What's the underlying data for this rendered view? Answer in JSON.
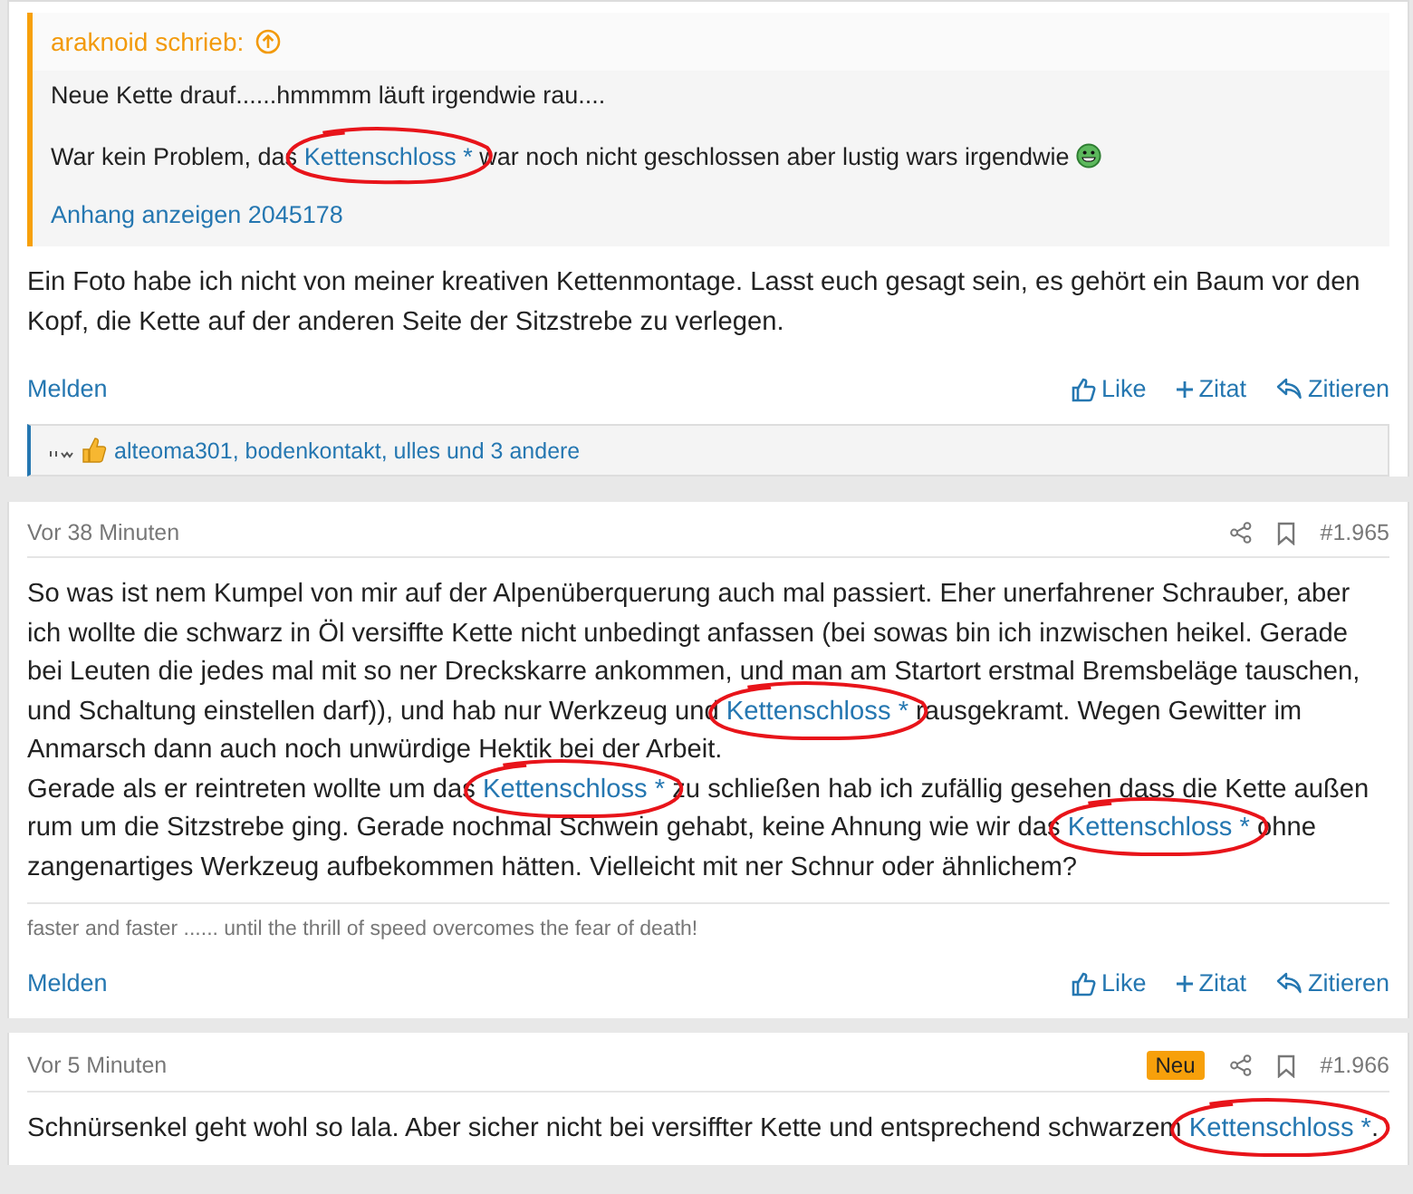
{
  "posts": [
    {
      "quote": {
        "author": "araknoid schrieb:",
        "lines": [
          [
            {
              "kind": "text",
              "text": "Neue Kette drauf......hmmmm läuft irgendwie rau...."
            }
          ],
          [
            {
              "kind": "text",
              "text": "War kein Problem, das "
            },
            {
              "kind": "link",
              "text": "Kettenschloss *",
              "circled": true
            },
            {
              "kind": "text",
              "text": " war noch nicht geschlossen aber lustig wars irgendwie "
            },
            {
              "kind": "smiley"
            }
          ]
        ],
        "attachment": "Anhang anzeigen 2045178"
      },
      "body": [
        [
          {
            "kind": "text",
            "text": "Ein Foto habe ich nicht von meiner kreativen Kettenmontage. Lasst euch gesagt sein, es gehört ein Baum vor den Kopf, die Kette auf der anderen Seite der Sitzstrebe zu verlegen."
          }
        ]
      ],
      "actions": {
        "report": "Melden",
        "like": "Like",
        "quote": "Zitat",
        "reply": "Zitieren"
      },
      "reactions": "alteoma301, bodenkontakt, ulles und 3 andere"
    },
    {
      "header": {
        "time": "Vor 38 Minuten",
        "number": "#1.965"
      },
      "body": [
        [
          {
            "kind": "text",
            "text": "So was ist nem Kumpel von mir auf der Alpenüberquerung auch mal passiert. Eher unerfahrener Schrauber, aber ich wollte die schwarz in Öl versiffte Kette nicht unbedingt anfassen (bei sowas bin ich inzwischen heikel. Gerade bei Leuten die jedes mal mit so ner Dreckskarre ankommen, und man am Startort erstmal Bremsbeläge tauschen, und Schaltung einstellen darf)), und hab nur Werkzeug und "
          },
          {
            "kind": "link",
            "text": "Kettenschloss *",
            "circled": true
          },
          {
            "kind": "text",
            "text": " rausgekramt. Wegen Gewitter im Anmarsch dann auch noch unwürdige Hektik bei der Arbeit."
          }
        ],
        [
          {
            "kind": "text",
            "text": "Gerade als er reintreten wollte um das "
          },
          {
            "kind": "link",
            "text": "Kettenschloss *",
            "circled": true
          },
          {
            "kind": "text",
            "text": " zu schließen hab ich zufällig gesehen dass die Kette außen rum um die Sitzstrebe ging. Gerade nochmal Schwein gehabt, keine Ahnung wie wir das "
          },
          {
            "kind": "link",
            "text": "Kettenschloss *",
            "circled": true
          },
          {
            "kind": "text",
            "text": " ohne zangenartiges Werkzeug aufbekommen hätten. Vielleicht mit ner Schnur oder ähnlichem?"
          }
        ]
      ],
      "signature": "faster and faster ...... until the thrill of speed overcomes the fear of death!",
      "actions": {
        "report": "Melden",
        "like": "Like",
        "quote": "Zitat",
        "reply": "Zitieren"
      }
    },
    {
      "header": {
        "time": "Vor 5 Minuten",
        "badge": "Neu",
        "number": "#1.966"
      },
      "body": [
        [
          {
            "kind": "text",
            "text": "Schnürsenkel geht wohl so lala. Aber sicher nicht bei versiffter Kette und entsprechend schwarzem "
          },
          {
            "kind": "link",
            "text": "Kettenschloss *",
            "circled": true
          },
          {
            "kind": "text",
            "text": "."
          }
        ]
      ]
    }
  ]
}
